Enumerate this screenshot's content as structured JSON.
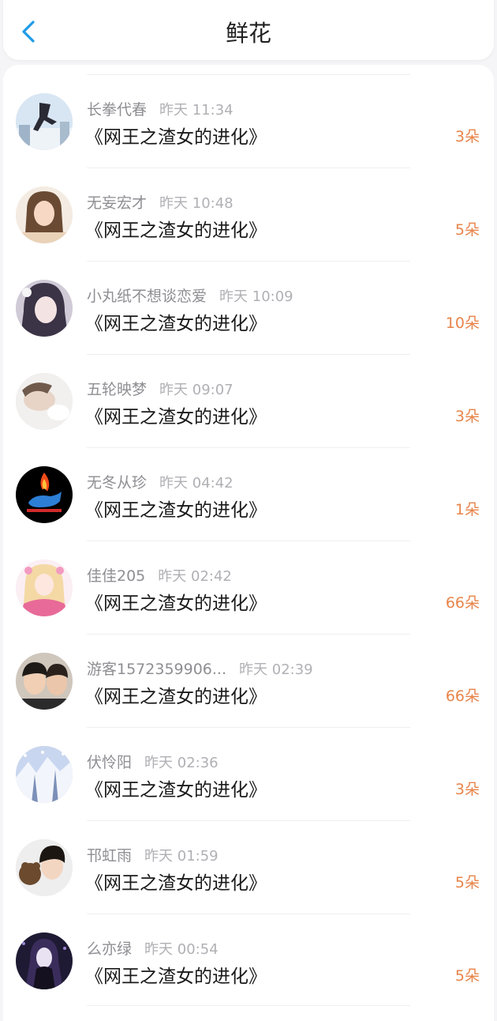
{
  "header": {
    "title": "鲜花",
    "back_icon": "chevron-left-icon",
    "accent": "#1e9be8"
  },
  "list": {
    "items": [
      {
        "user": "长拳代春",
        "time": "昨天 11:34",
        "book": "《网王之渣女的进化》",
        "count": "3朵"
      },
      {
        "user": "无妄宏才",
        "time": "昨天 10:48",
        "book": "《网王之渣女的进化》",
        "count": "5朵"
      },
      {
        "user": "小丸纸不想谈恋爱",
        "time": "昨天 10:09",
        "book": "《网王之渣女的进化》",
        "count": "10朵"
      },
      {
        "user": "五轮映梦",
        "time": "昨天 09:07",
        "book": "《网王之渣女的进化》",
        "count": "3朵"
      },
      {
        "user": "无冬从珍",
        "time": "昨天 04:42",
        "book": "《网王之渣女的进化》",
        "count": "1朵"
      },
      {
        "user": "佳佳205",
        "time": "昨天 02:42",
        "book": "《网王之渣女的进化》",
        "count": "66朵"
      },
      {
        "user": "游客1572359906...",
        "time": "昨天 02:39",
        "book": "《网王之渣女的进化》",
        "count": "66朵"
      },
      {
        "user": "伏怜阳",
        "time": "昨天 02:36",
        "book": "《网王之渣女的进化》",
        "count": "3朵"
      },
      {
        "user": "邗虹雨",
        "time": "昨天 01:59",
        "book": "《网王之渣女的进化》",
        "count": "5朵"
      },
      {
        "user": "么亦绿",
        "time": "昨天 00:54",
        "book": "《网王之渣女的进化》",
        "count": "5朵"
      }
    ]
  },
  "colors": {
    "count": "#e8844a",
    "name": "#8e8e93",
    "time": "#b0b0b5",
    "book": "#1a1a1a"
  }
}
